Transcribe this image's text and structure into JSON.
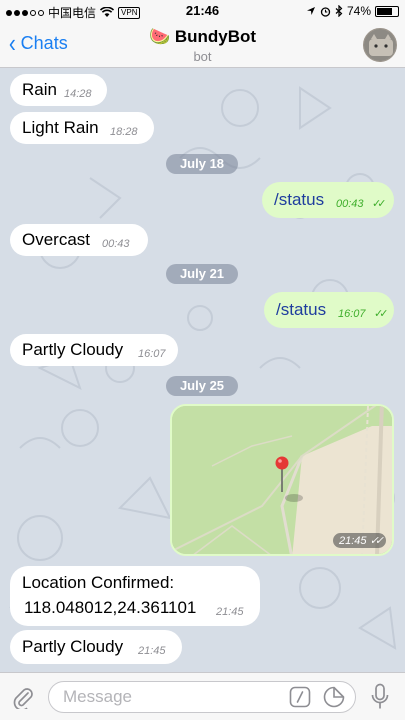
{
  "status_bar": {
    "carrier": "中国电信",
    "vpn": "VPN",
    "time": "21:46",
    "battery": "74%",
    "battery_level": 0.74
  },
  "header": {
    "back_label": "Chats",
    "title": "🍉 BundyBot",
    "subtitle": "bot"
  },
  "messages": [
    {
      "text": "Rain",
      "time": "14:28"
    },
    {
      "text": "Light Rain",
      "time": "18:28"
    },
    {
      "date": "July 18"
    },
    {
      "text": "/status",
      "time": "00:43"
    },
    {
      "text": "Overcast",
      "time": "00:43"
    },
    {
      "date": "July 21"
    },
    {
      "text": "/status",
      "time": "16:07"
    },
    {
      "text": "Partly Cloudy",
      "time": "16:07"
    },
    {
      "date": "July 25"
    },
    {
      "time": "21:45"
    },
    {
      "text": "Location Confirmed:",
      "text2": "118.048012,24.361101",
      "time": "21:45"
    },
    {
      "text": "Partly Cloudy",
      "time": "21:45"
    }
  ],
  "input": {
    "placeholder": "Message"
  },
  "colors": {
    "accent": "#1a7ff2",
    "outgoing_bubble": "#e0fbc8",
    "outgoing_text": "#1f3d9e",
    "read_check": "#3fae2c"
  },
  "icons": [
    "attach-icon",
    "command-icon",
    "sticker-icon",
    "microphone-icon",
    "location-pin-icon"
  ]
}
